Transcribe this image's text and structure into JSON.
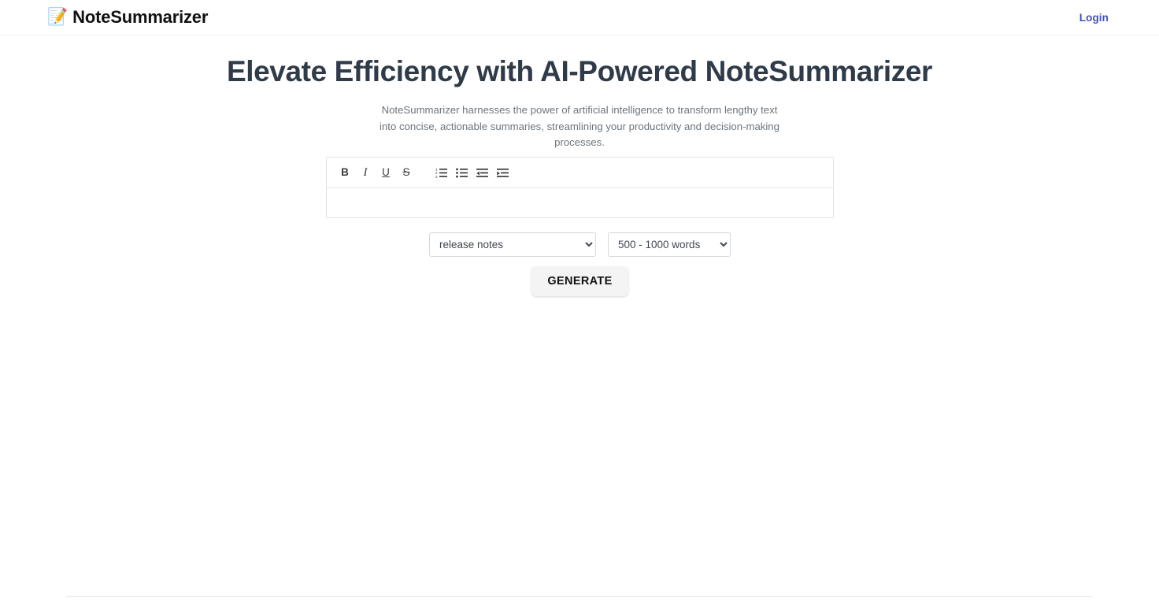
{
  "header": {
    "brand_icon": "memo-pencil-icon",
    "brand_name": "NoteSummarizer",
    "login_label": "Login",
    "login_color": "#3f51b5"
  },
  "hero": {
    "title": "Elevate Efficiency with AI-Powered NoteSummarizer",
    "subtitle": "NoteSummarizer harnesses the power of artificial intelligence to transform lengthy text into concise, actionable summaries, streamlining your productivity and decision-making processes.",
    "title_color": "#303b4a",
    "subtitle_color": "#6c757d"
  },
  "editor": {
    "toolbar": [
      {
        "name": "bold-icon",
        "label": "B",
        "title": "Bold"
      },
      {
        "name": "italic-icon",
        "label": "I",
        "title": "Italic"
      },
      {
        "name": "underline-icon",
        "label": "U",
        "title": "Underline"
      },
      {
        "name": "strikethrough-icon",
        "label": "S",
        "title": "Strikethrough"
      },
      {
        "name": "ordered-list-icon",
        "label": "",
        "title": "Numbered list"
      },
      {
        "name": "unordered-list-icon",
        "label": "",
        "title": "Bulleted list"
      },
      {
        "name": "outdent-icon",
        "label": "",
        "title": "Decrease indent"
      },
      {
        "name": "indent-icon",
        "label": "",
        "title": "Increase indent"
      }
    ],
    "content": "",
    "placeholder": ""
  },
  "controls": {
    "summary_type": {
      "selected": "release notes",
      "options": [
        "release notes"
      ]
    },
    "summary_length": {
      "selected": "500 - 1000 words",
      "options": [
        "500 - 1000 words"
      ]
    }
  },
  "actions": {
    "generate_label": "GENERATE"
  }
}
